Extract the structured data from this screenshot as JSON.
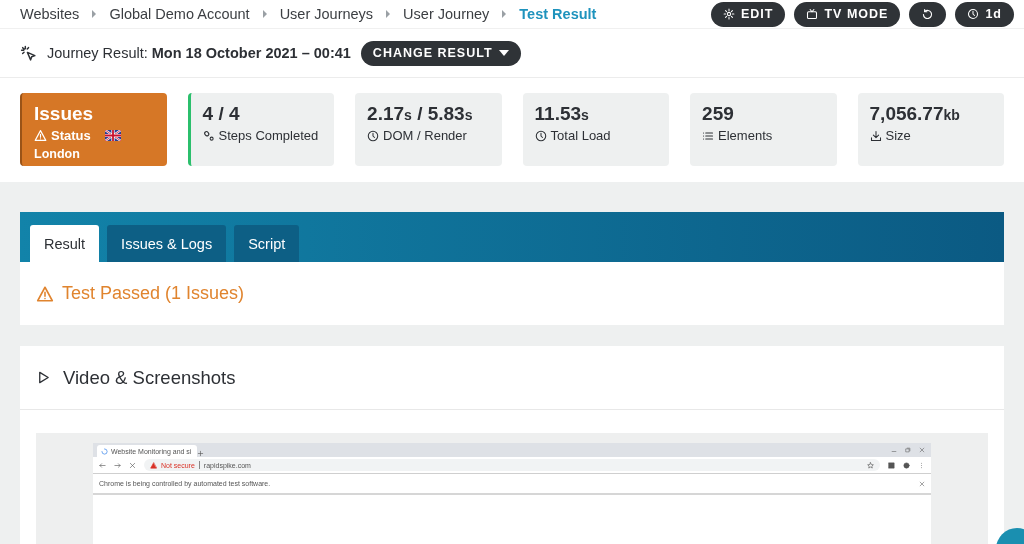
{
  "breadcrumbs": [
    {
      "label": "Websites",
      "selected": false
    },
    {
      "label": "Global Demo Account",
      "selected": false
    },
    {
      "label": "User Journeys",
      "selected": false
    },
    {
      "label": "User Journey",
      "selected": false
    },
    {
      "label": "Test Result",
      "selected": true
    }
  ],
  "toolbar_buttons": [
    {
      "kind": "gear",
      "label": "EDIT"
    },
    {
      "kind": "tv",
      "label": "TV MODE"
    },
    {
      "kind": "refresh"
    },
    {
      "kind": "clock",
      "label": "1d"
    }
  ],
  "journey": {
    "label": "Journey Result:",
    "value": "Mon 18 October 2021 – 00:41",
    "button": "CHANGE RESULT"
  },
  "stats": [
    {
      "kind": "status",
      "value": [
        {
          "text": "Issues",
          "kind": "number"
        }
      ],
      "label": "Status",
      "location": "London"
    },
    {
      "kind": "steps",
      "value": [
        {
          "text": "4 / 4",
          "kind": "number"
        }
      ],
      "label": "Steps Completed"
    },
    {
      "kind": "clock",
      "value": [
        {
          "text": "2.17",
          "kind": "number"
        },
        {
          "text": "s",
          "kind": "unit"
        },
        {
          "text": " / 5.83",
          "kind": "number"
        },
        {
          "text": "s",
          "kind": "unit"
        }
      ],
      "label": "DOM / Render"
    },
    {
      "kind": "clock",
      "value": [
        {
          "text": "11.53",
          "kind": "number"
        },
        {
          "text": "s",
          "kind": "unit"
        }
      ],
      "label": "Total Load"
    },
    {
      "kind": "list",
      "value": [
        {
          "text": "259",
          "kind": "number"
        }
      ],
      "label": "Elements"
    },
    {
      "kind": "download",
      "value": [
        {
          "text": "7,056.77",
          "kind": "number"
        },
        {
          "text": "kb",
          "kind": "unit"
        }
      ],
      "label": "Size"
    }
  ],
  "tabs": [
    {
      "label": "Result",
      "selected": true
    },
    {
      "label": "Issues & Logs",
      "selected": false
    },
    {
      "label": "Script",
      "selected": false
    }
  ],
  "result": {
    "text": "Test Passed (1 Issues)"
  },
  "video_section": {
    "title": "Video & Screenshots"
  },
  "screenshot": {
    "tab_title": "Website Monitoring and si",
    "security": "Not secure",
    "url": "rapidspike.com",
    "infobar": "Chrome is being controlled by automated test software."
  }
}
